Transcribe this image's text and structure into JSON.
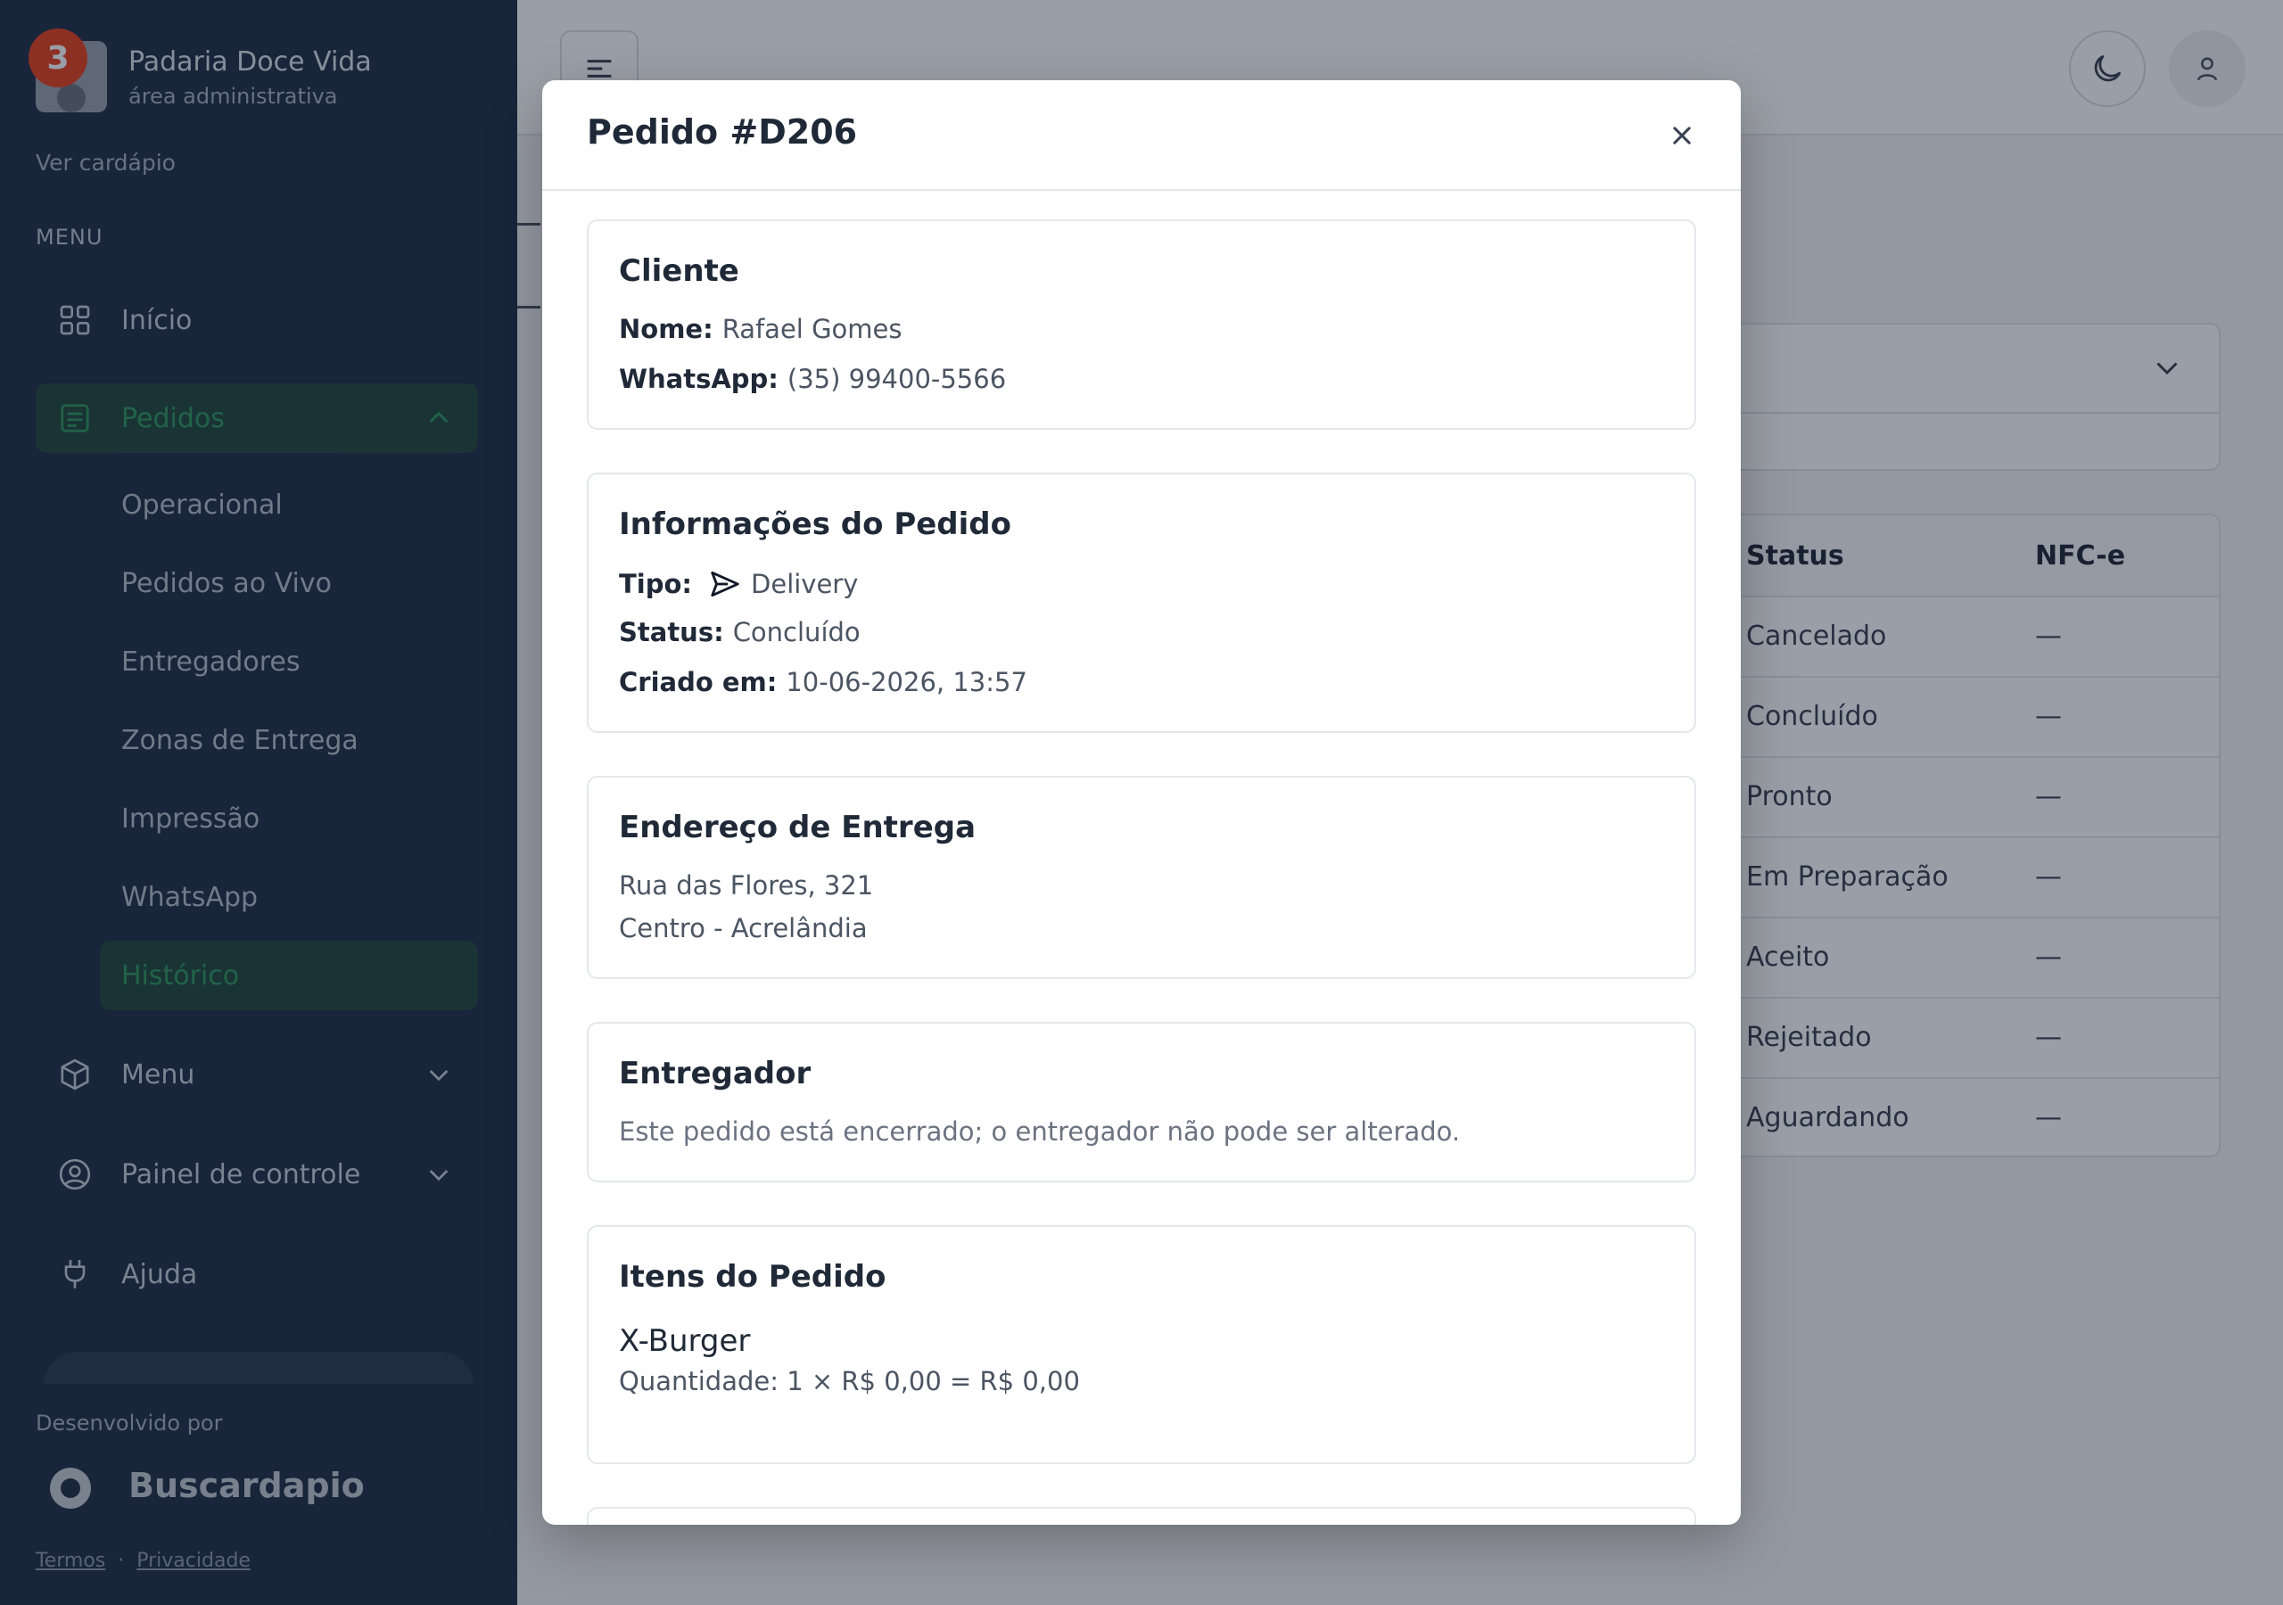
{
  "colors": {
    "sidebar_bg": "#203046",
    "accent_green": "#2f9a5e",
    "active_bg": "#23493f",
    "badge_red": "#e8431f",
    "overlay": "rgba(15,23,42,0.42)"
  },
  "sidebar": {
    "notification_count": "3",
    "brand_name": "Padaria Doce Vida",
    "brand_subtitle": "área administrativa",
    "view_menu_link": "Ver cardápio",
    "section_title": "MENU",
    "items": [
      {
        "label": "Início",
        "icon": "grid-icon"
      },
      {
        "label": "Pedidos",
        "icon": "list-icon",
        "expanded": true
      },
      {
        "label": "Menu",
        "icon": "box-icon"
      },
      {
        "label": "Painel de controle",
        "icon": "user-circle-icon"
      },
      {
        "label": "Ajuda",
        "icon": "plug-icon"
      }
    ],
    "pedidos_subitems": [
      {
        "label": "Operacional"
      },
      {
        "label": "Pedidos ao Vivo"
      },
      {
        "label": "Entregadores"
      },
      {
        "label": "Zonas de Entrega"
      },
      {
        "label": "Impressão"
      },
      {
        "label": "WhatsApp"
      },
      {
        "label": "Histórico",
        "active": true
      }
    ],
    "footer": {
      "developed_by": "Desenvolvido por",
      "company": "Buscardapio",
      "terms": "Termos",
      "separator": "·",
      "privacy": "Privacidade"
    }
  },
  "background_table": {
    "headers": {
      "status": "Status",
      "nfce": "NFC-e"
    },
    "rows": [
      {
        "status": "Cancelado",
        "nfce": "—"
      },
      {
        "status": "Concluído",
        "nfce": "—"
      },
      {
        "status": "Pronto",
        "nfce": "—"
      },
      {
        "status": "Em Preparação",
        "nfce": "—"
      },
      {
        "status": "Aceito",
        "nfce": "—"
      },
      {
        "status": "Rejeitado",
        "nfce": "—"
      },
      {
        "status": "Aguardando",
        "nfce": "—"
      }
    ]
  },
  "modal": {
    "title": "Pedido #D206",
    "cliente": {
      "title": "Cliente",
      "name_label": "Nome:",
      "name_value": "Rafael Gomes",
      "whatsapp_label": "WhatsApp:",
      "whatsapp_value": "(35) 99400-5566"
    },
    "info": {
      "title": "Informações do Pedido",
      "type_label": "Tipo:",
      "type_icon": "send-icon",
      "type_value": "Delivery",
      "status_label": "Status:",
      "status_value": "Concluído",
      "created_label": "Criado em:",
      "created_value": "10-06-2026, 13:57"
    },
    "address": {
      "title": "Endereço de Entrega",
      "line1": "Rua das Flores, 321",
      "line2": "Centro - Acrelândia"
    },
    "courier": {
      "title": "Entregador",
      "note": "Este pedido está encerrado; o entregador não pode ser alterado."
    },
    "items": {
      "title": "Itens do Pedido",
      "list": [
        {
          "name": "X-Burger",
          "detail": "Quantidade: 1 × R$ 0,00 = R$ 0,00"
        }
      ]
    }
  }
}
